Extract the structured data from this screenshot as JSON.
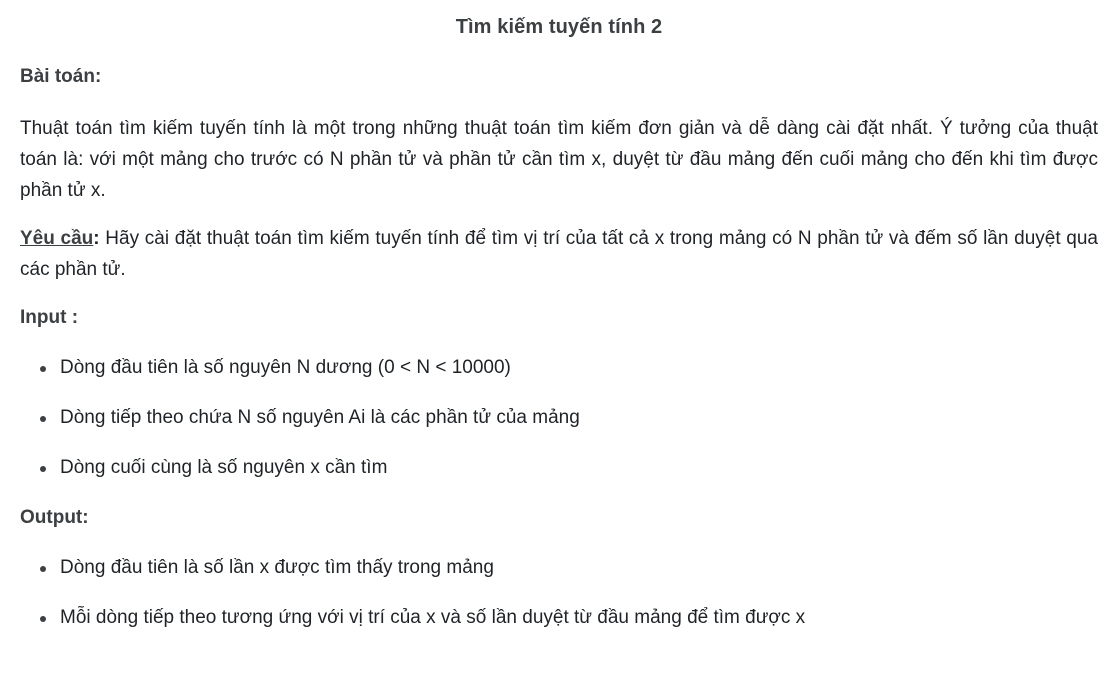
{
  "title": "Tìm kiếm tuyến tính 2",
  "problem": {
    "heading": "Bài toán:",
    "text": "Thuật toán tìm kiếm tuyến tính là một trong những thuật toán tìm kiếm đơn giản và dễ dàng cài đặt nhất. Ý tưởng của thuật toán là: với một mảng cho trước có N phần tử và phần tử cần tìm x, duyệt từ đầu mảng đến cuối mảng cho đến khi tìm được phần tử x."
  },
  "requirement": {
    "label": "Yêu cầu",
    "colon": ":",
    "text": " Hãy cài đặt thuật toán tìm kiếm tuyến tính để tìm vị trí của tất cả x trong mảng có N phần tử và đếm số lần duyệt qua các phần tử."
  },
  "input": {
    "heading": "Input :",
    "items": [
      "Dòng đầu tiên là số nguyên N dương (0 < N < 10000)",
      "Dòng tiếp theo chứa N số nguyên Ai là các phần tử của mảng",
      "Dòng cuối cùng là số nguyên x cần tìm"
    ]
  },
  "output": {
    "heading": "Output:",
    "items": [
      "Dòng đầu tiên là số lần x được tìm thấy trong mảng",
      "Mỗi dòng tiếp theo tương ứng với vị trí của x và số lần duyệt từ đầu mảng để tìm được x"
    ]
  }
}
